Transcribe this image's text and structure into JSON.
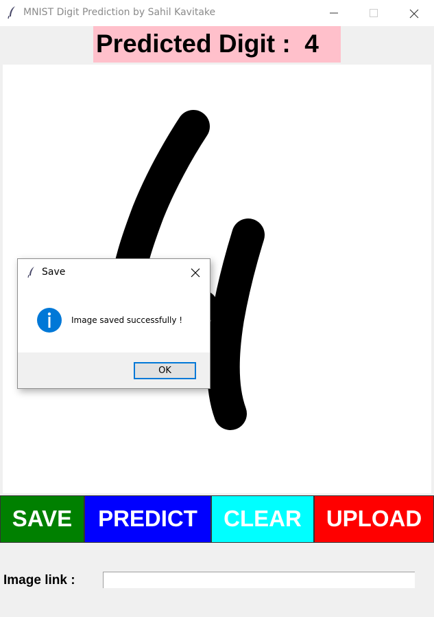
{
  "window": {
    "title": "MNIST Digit Prediction by Sahil Kavitake",
    "icon": "feather-icon",
    "controls": [
      "minimize-icon",
      "maximize-icon",
      "close-icon"
    ]
  },
  "prediction": {
    "label": "Predicted Digit :  4"
  },
  "canvas": {
    "content": "hand-drawn digit 4 in black strokes"
  },
  "buttons": {
    "save": {
      "label": "SAVE",
      "color": "#008000"
    },
    "predict": {
      "label": "PREDICT",
      "color": "#0000ff"
    },
    "clear": {
      "label": "CLEAR",
      "color": "#00ffff"
    },
    "upload": {
      "label": "UPLOAD",
      "color": "#ff0000"
    }
  },
  "image_link": {
    "label": "Image link :",
    "value": ""
  },
  "dialog": {
    "title": "Save",
    "message": "Image saved successfully !",
    "ok_label": "OK",
    "icon": "info-icon",
    "accent": "#0078d7"
  }
}
